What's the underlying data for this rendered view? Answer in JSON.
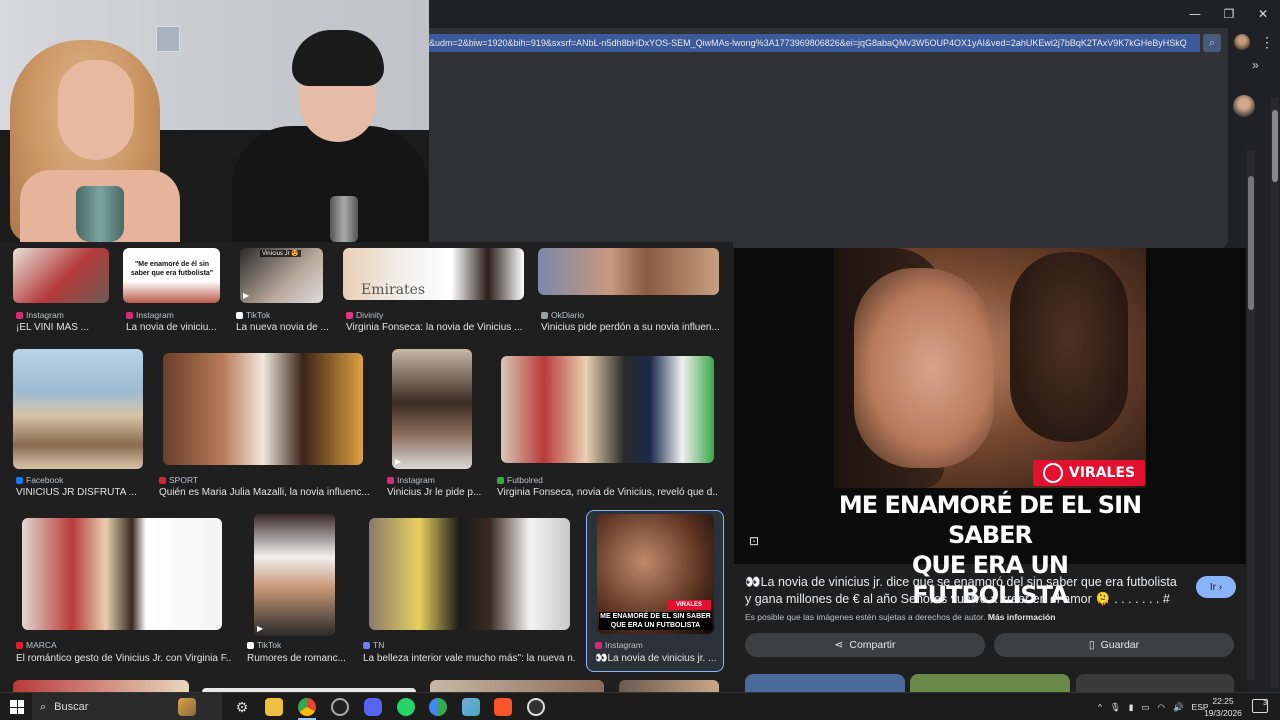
{
  "browser": {
    "url": "&udm=2&biw=1920&bih=919&sxsrf=ANbL-n5dh8bHDxYOS-SEM_QiwMAs-lwong%3A1773969806826&ei=jqG8abaQMv3W5OUP4OX1yAI&ved=2ahUKEwi2j7bBqK2TAxV9K7kGHeByHSkQ",
    "window_controls": {
      "minimize": "—",
      "restore": "❐",
      "close": "✕"
    },
    "menu_glyph": "⋮",
    "side_chevron": "»"
  },
  "results": [
    {
      "source": "Instagram",
      "title": "¡EL VINI MÁS ...",
      "src_color": "#d62976"
    },
    {
      "source": "Instagram",
      "title": "La novia de viniciu...",
      "src_color": "#d62976",
      "overlay_text": "\"Me enamoré de él sin saber que era futbolista\""
    },
    {
      "source": "TikTok",
      "title": "La nueva novia de ...",
      "src_color": "#ffffff",
      "overlay_text": "Vinícius Jr 😍"
    },
    {
      "source": "Divinity",
      "title": "Virginia Fonseca: la novia de Vinicius ...",
      "src_color": "#e0338a"
    },
    {
      "source": "OkDiario",
      "title": "Vinicius pide perdón a su novia influen...",
      "src_color": "#9aa0a6"
    },
    {
      "source": "Facebook",
      "title": "VINICIUS JR DISFRUTA ...",
      "src_color": "#1877f2"
    },
    {
      "source": "SPORT",
      "title": "Quién es Maria Julia Mazalli, la novia influenc...",
      "src_color": "#d9262a"
    },
    {
      "source": "Instagram",
      "title": "Vinicius Jr le pide p...",
      "src_color": "#d62976"
    },
    {
      "source": "Futbolred",
      "title": "Virginia Fonseca, novia de Vinicius, reveló que d...",
      "src_color": "#3aa845"
    },
    {
      "source": "MARCA",
      "title": "El romántico gesto de Vinicius Jr. con Virginia F...",
      "src_color": "#e5202a"
    },
    {
      "source": "TikTok",
      "title": "Rumores de romanc...",
      "src_color": "#ffffff"
    },
    {
      "source": "TN",
      "title": "La belleza interior vale mucho más\": la nueva n...",
      "src_color": "#6c7cff"
    },
    {
      "source": "Instagram",
      "title": "👀La novia de vinicius jr. ...",
      "src_color": "#d62976"
    }
  ],
  "preview": {
    "badge": "VIRALES",
    "headline_line1": "ME ENAMORÉ DE EL SIN SABER",
    "headline_line2": "QUE ERA UN FUTBOLISTA",
    "description": "👀La novia de vinicius jr. dice que se enamoró del sin saber que era futbolista y gana millones de € al año Señores vuelvo a creer en el amor 🫠 . . . . . . . #",
    "go_button": "Ir",
    "rights_text": "Es posible que las imágenes estén sujetas a derechos de autor.",
    "rights_link": "Más información",
    "share_button": "Compartir",
    "save_button": "Guardar"
  },
  "thumb_mini": {
    "badge": "VIRALES",
    "headline": "ME ENAMORÉ DE EL SIN SABER QUE ERA UN FUTBOLISTA"
  },
  "taskbar": {
    "search_label": "Buscar",
    "lang": "ESP",
    "time": "22:25",
    "date": "19/3/2026",
    "notifications": "3"
  }
}
